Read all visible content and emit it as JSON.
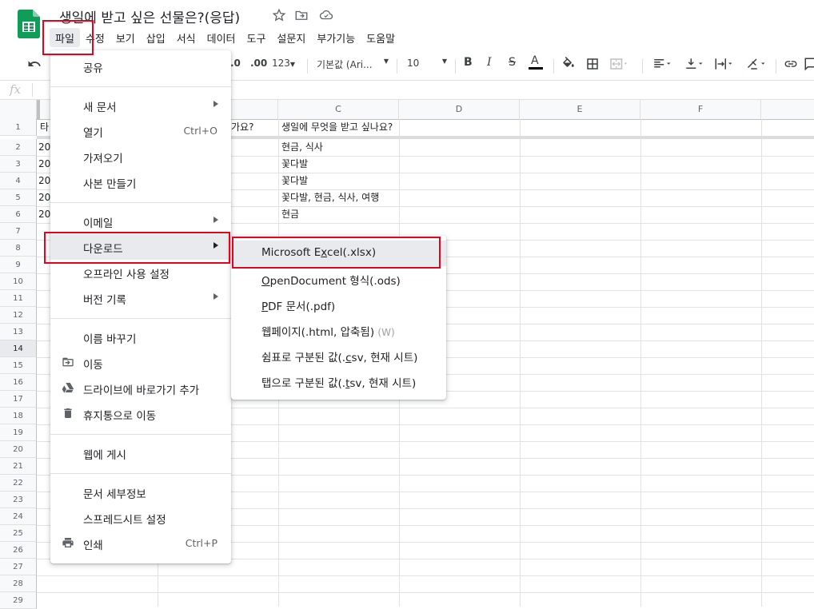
{
  "document": {
    "title": "생일에 받고 싶은 선물은?(응답)"
  },
  "menubar": {
    "items": [
      "파일",
      "수정",
      "보기",
      "삽입",
      "서식",
      "데이터",
      "도구",
      "설문지",
      "부가기능",
      "도움말"
    ]
  },
  "toolbar": {
    "decimal_decrease": ".0",
    "decimal_increase": ".00",
    "number_format": "123",
    "font_family": "기본값 (Ari...",
    "font_size": "10",
    "bold": "B",
    "italic": "I",
    "strikethrough": "S",
    "text_color": "A"
  },
  "formula_bar": {
    "fx_label": "fx"
  },
  "grid": {
    "columns": [
      "",
      "C",
      "D",
      "E",
      "F"
    ],
    "rows": [
      "1",
      "2",
      "3",
      "4",
      "5",
      "6",
      "7",
      "8",
      "9",
      "10",
      "11",
      "12",
      "13",
      "14",
      "15",
      "16",
      "17",
      "18",
      "19",
      "20",
      "21",
      "22",
      "23",
      "24",
      "25",
      "26",
      "27",
      "28",
      "29"
    ],
    "row1": {
      "a": "타",
      "b": "가요?",
      "c": "생일에 무엇을 받고 싶나요?"
    },
    "col_a_visible": [
      "20",
      "20",
      "20",
      "20",
      "20"
    ],
    "col_c_values": [
      "현금, 식사",
      "꽃다발",
      "꽃다발",
      "꽃다발, 현금, 식사, 여행",
      "현금"
    ]
  },
  "file_menu": {
    "share": "공유",
    "new": "새 문서",
    "open": "열기",
    "open_shortcut": "Ctrl+O",
    "import": "가져오기",
    "make_copy": "사본 만들기",
    "email": "이메일",
    "download": "다운로드",
    "offline": "오프라인 사용 설정",
    "version_history": "버전 기록",
    "rename": "이름 바꾸기",
    "move": "이동",
    "add_shortcut": "드라이브에 바로가기 추가",
    "move_to_trash": "휴지통으로 이동",
    "publish": "웹에 게시",
    "details": "문서 세부정보",
    "settings": "스프레드시트 설정",
    "print": "인쇄",
    "print_shortcut": "Ctrl+P"
  },
  "download_submenu": {
    "xlsx_pre": "Microsoft E",
    "xlsx_u": "x",
    "xlsx_post": "cel(.xlsx)",
    "ods_u": "O",
    "ods_post": "penDocument 형식(.ods)",
    "pdf_u": "P",
    "pdf_post": "DF 문서(.pdf)",
    "html_main": "웹페이지(.html, 압축됨)",
    "html_hint": "(W)",
    "csv_pre": "쉼표로 구분된 값(.",
    "csv_u": "c",
    "csv_post": "sv, 현재 시트)",
    "tsv_pre": "탭으로 구분된 값(.",
    "tsv_u": "t",
    "tsv_post": "sv, 현재 시트)"
  },
  "colors": {
    "highlight": "#e8001c",
    "sheets_green": "#0f9d58",
    "menu_hover": "#e8eaed"
  }
}
